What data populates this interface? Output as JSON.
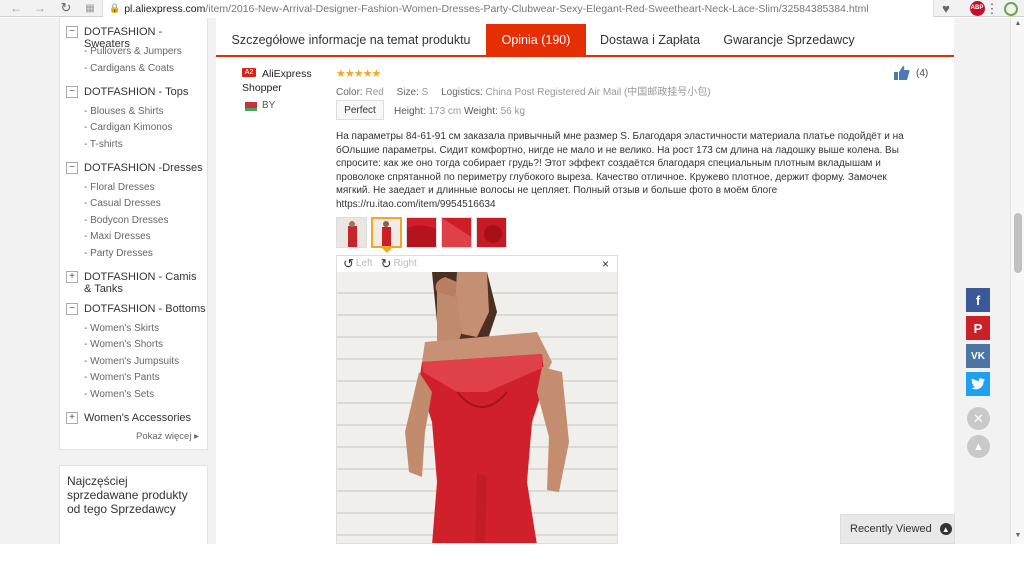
{
  "browser": {
    "url_host": "pl.aliexpress.com",
    "url_path": "/item/2016-New-Arrival-Designer-Fashion-Women-Dresses-Party-Clubwear-Sexy-Elegant-Red-Sweetheart-Neck-Lace-Slim/32584385384.html",
    "abp_label": "ABP"
  },
  "sidebar": {
    "categories": [
      {
        "toggle": "−",
        "label": "DOTFASHION - Sweaters",
        "subs": [
          "- Pullovers & Jumpers",
          "- Cardigans & Coats"
        ]
      },
      {
        "toggle": "−",
        "label": "DOTFASHION - Tops",
        "subs": [
          "- Blouses & Shirts",
          "- Cardigan Kimonos",
          "- T-shirts"
        ]
      },
      {
        "toggle": "−",
        "label": "DOTFASHION -Dresses",
        "subs": [
          "- Floral Dresses",
          "- Casual Dresses",
          "- Bodycon Dresses",
          "-  Maxi Dresses",
          "- Party Dresses"
        ]
      },
      {
        "toggle": "+",
        "label": "DOTFASHION - Camis & Tanks",
        "subs": []
      },
      {
        "toggle": "−",
        "label": "DOTFASHION - Bottoms",
        "subs": [
          "- Women's Skirts",
          "- Women's Shorts",
          "- Women's Jumpsuits",
          "- Women's Pants",
          "- Women's Sets"
        ]
      },
      {
        "toggle": "+",
        "label": "Women's Accessories",
        "subs": []
      }
    ],
    "more_label": "Pokaż więcej ▸",
    "bestsellers_title": "Najczęściej sprzedawane produkty od tego Sprzedawcy"
  },
  "tabs": [
    {
      "label": "Szczegółowe informacje na temat produktu",
      "active": false
    },
    {
      "label": "Opinia (190)",
      "active": true
    },
    {
      "label": "Dostawa i Zapłata",
      "active": false
    },
    {
      "label": "Gwarancje Sprzedawcy",
      "active": false
    }
  ],
  "review": {
    "author_badge": "A2",
    "author": "AliExpress Shopper",
    "country": "BY",
    "stars": "★★★★★",
    "color_label": "Color:",
    "color_value": "Red",
    "size_label": "Size:",
    "size_value": "S",
    "logistics_label": "Logistics:",
    "logistics_value": "China Post Registered Air Mail (中国邮政挂号小包)",
    "fit": "Perfect",
    "height_label": "Height:",
    "height_value": "173 cm",
    "weight_label": "Weight:",
    "weight_value": "56 kg",
    "text": "На параметры 84-61-91 см заказала привычный мне размер S. Благодаря эластичности материала платье подойдёт и на бОльшие параметры. Сидит комфортно, нигде не мало и не велико. На рост 173 см длина на ладошку выше колена. Вы спросите: как же оно тогда собирает грудь?! Этот эффект создаётся благодаря специальным плотным вкладышам и проволоке спрятанной по периметру глубокого выреза. Качество отличное. Кружево плотное, держит форму. Замочек мягкий. Не заедает и длинные волосы не цепляет. Полный отзыв и больше фото в моём блоге https://ru.itao.com/item/9954516634",
    "likes": "(4)",
    "viewer_left": "Left",
    "viewer_right": "Right",
    "viewer_close": "×",
    "thumb_count": 5,
    "selected_thumb": 2
  },
  "recently_viewed": "Recently Viewed",
  "colors": {
    "accent": "#e62e04",
    "star": "#f5a623",
    "facebook": "#3b5998",
    "pinterest": "#cb2027",
    "vk": "#4c75a3",
    "twitter": "#1da1f2"
  }
}
